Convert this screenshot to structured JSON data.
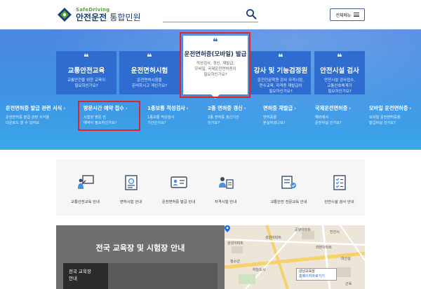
{
  "header": {
    "logo_en": "SafeDriving",
    "logo_ko_main": "안전운전",
    "logo_ko_sub": "통합민원",
    "search_placeholder": "",
    "menu_label": "전체메뉴"
  },
  "hero": {
    "cards": [
      {
        "title": "교통안전교육",
        "desc1": "교통안전을 위한 교육이",
        "desc2": "필요하신가요?"
      },
      {
        "title": "운전면허시험",
        "desc1": "운전면허시험을",
        "desc2": "준비하시고 계신가요?"
      },
      {
        "title": "운전면허증(모바일) 발급",
        "desc1": "적성검사, 갱신, 재발급,",
        "desc2": "모바일, 국제운전면허증이",
        "desc3": "필요하신가요?"
      },
      {
        "title": "강사 및 기능검정원",
        "desc1": "운전전문학원 강사 자격시험,",
        "desc2": "연수교육, 자격증 재발급이",
        "desc3": "필요하신가요?"
      },
      {
        "title": "안전시설 검사",
        "desc1": "안전시설 검사접수,",
        "desc2": "교통신호체계가",
        "desc3": "필요하신가요?"
      }
    ],
    "subs": [
      {
        "title": "운전면허증 발급 관련 서식",
        "desc1": "운전면허증 발급 관련 서식을",
        "desc2": "다운로드 할 수 있어요"
      },
      {
        "title": "방문시간 예약 접수",
        "desc1": "시험장 방문 전",
        "desc2": "예약이 필요하신가요?"
      },
      {
        "title": "1종보통 적성검사",
        "desc1": "1종보통 적성검사",
        "desc2": "기간인가요?"
      },
      {
        "title": "2종 면허증 갱신",
        "desc1": "2종 면허증 갱신기간",
        "desc2": "인가요?"
      },
      {
        "title": "면허증 재발급",
        "desc1": "면허증을",
        "desc2": "분실하셨나요?"
      },
      {
        "title": "국제운전면허증",
        "desc1": "해외에서",
        "desc2": "운전하실 건가요?"
      },
      {
        "title": "모바일 운전면허증",
        "desc1": "모바일 운전면허증을",
        "desc2": "발급하실 건가요?"
      }
    ],
    "arrow": "›"
  },
  "services": [
    {
      "label": "교통안전교육 안내",
      "icon": "instructor-board-icon"
    },
    {
      "label": "면허시험 안내",
      "icon": "exam-document-icon"
    },
    {
      "label": "운전면허증 발급 안내",
      "icon": "license-card-icon"
    },
    {
      "label": "자격시험 안내",
      "icon": "certificate-pen-icon"
    },
    {
      "label": "교통안전 전문교육 안내",
      "icon": "professional-training-icon"
    },
    {
      "label": "안전시설 검사 안내",
      "icon": "checklist-icon"
    }
  ],
  "bottom": {
    "title": "전국 교육장 및 시험장 안내",
    "side_label_1": "전국 교육장",
    "side_label_2": "안내"
  },
  "map": {
    "labels": [
      "공항아파트",
      "삼성아파트",
      "성원아파트",
      "진안시",
      "라본아파트",
      "청소년",
      "하늘도시",
      "대산실",
      "근육"
    ],
    "popup_name": "강남교육장",
    "popup_link": "홈페이지바로가기"
  },
  "colors": {
    "brand_navy": "#1a3f78",
    "brand_green": "#5aa532",
    "hero_blue": "#3f93e5",
    "card_blue": "#2e6dcf",
    "highlight_red": "#e0242c"
  }
}
